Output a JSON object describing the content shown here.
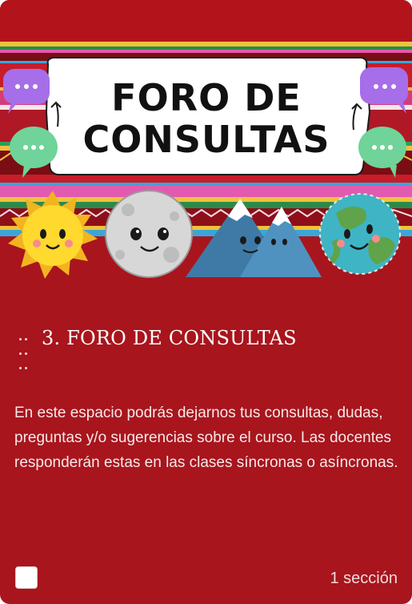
{
  "banner": {
    "heading_line1": "FORO DE",
    "heading_line2": "CONSULTAS"
  },
  "card": {
    "title": "3. FORO DE CONSULTAS",
    "description": "En este espacio podrás dejarnos tus consultas, dudas, preguntas y/o sugerencias sobre el curso. Las docentes responderán estas en las clases síncronas o asíncronas.",
    "section_count": "1 sección",
    "checkbox_checked": false
  },
  "colors": {
    "card_bg": "#a8151d",
    "text": "#ffffff",
    "bubble_purple": "#a66ee8",
    "bubble_green": "#6fd39a"
  },
  "icons": [
    "drag-handle-icon",
    "chat-bubble-icon",
    "sun-icon",
    "moon-icon",
    "mountains-icon",
    "earth-icon"
  ]
}
